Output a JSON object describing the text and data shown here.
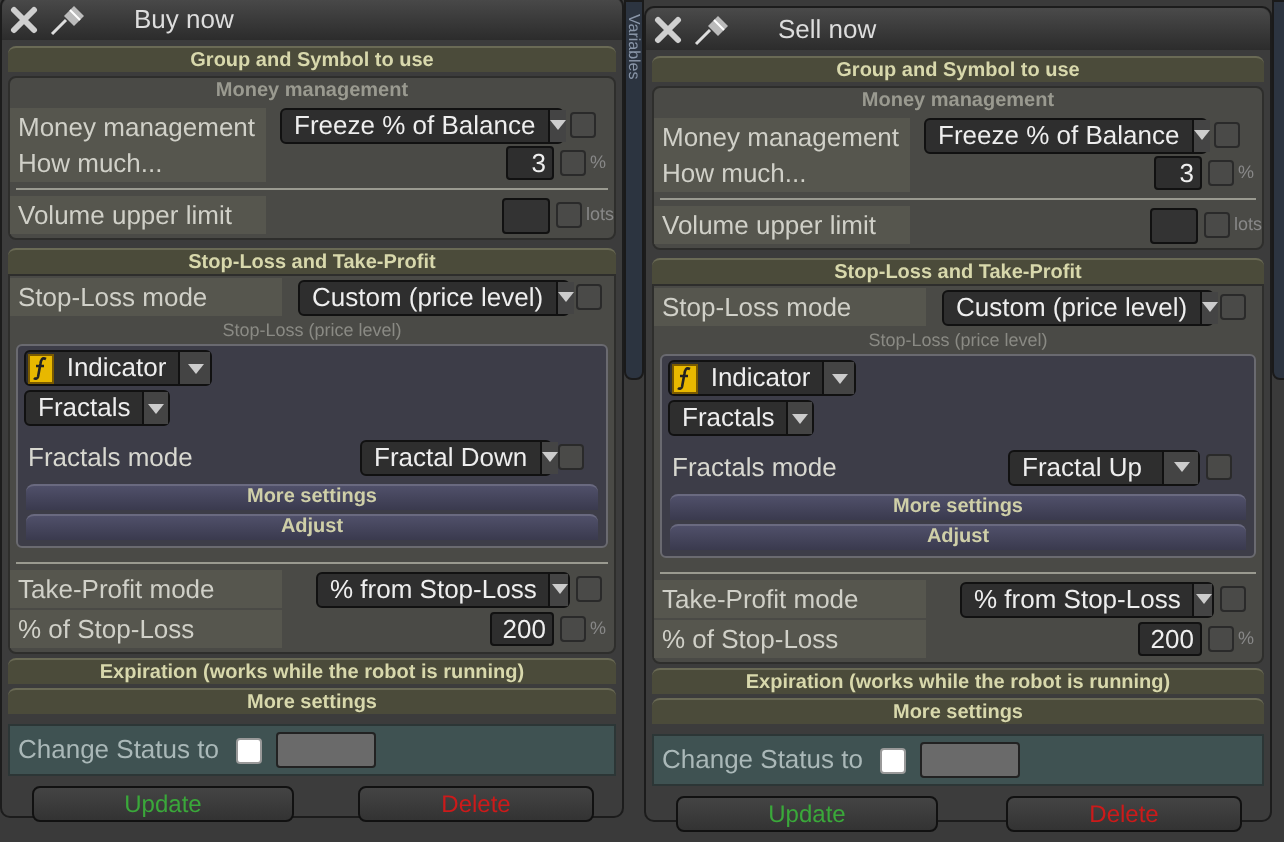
{
  "side_tab": "Variables",
  "windows": [
    {
      "title": "Buy now",
      "group_header": "Group and Symbol to use",
      "money": {
        "title": "Money management",
        "mode": {
          "label": "Money management",
          "value": "Freeze % of Balance",
          "checked": false
        },
        "amount": {
          "label": "How much...",
          "value": "3",
          "unit": "%",
          "checked": false
        },
        "volume_limit": {
          "label": "Volume upper limit",
          "unit": "lots",
          "checked": false
        }
      },
      "stop_take": {
        "title": "Stop-Loss and Take-Profit",
        "sl_mode": {
          "label": "Stop-Loss mode",
          "value": "Custom (price level)",
          "checked": false
        },
        "sl_subtitle": "Stop-Loss (price level)",
        "indicator": "Indicator",
        "indicator_type": "Fractals",
        "fractals_mode": {
          "label": "Fractals mode",
          "value": "Fractal Down",
          "checked": false
        },
        "buttons": [
          "More settings",
          "Adjust"
        ],
        "tp_mode": {
          "label": "Take-Profit mode",
          "value": "% from Stop-Loss",
          "checked": false
        },
        "tp_percent": {
          "label": "% of Stop-Loss",
          "value": "200",
          "unit": "%",
          "checked": false
        }
      },
      "sections": [
        "Expiration (works while the robot is running)",
        "More settings"
      ],
      "status": {
        "label": "Change Status to",
        "checked": false
      },
      "actions": [
        {
          "label": "Update",
          "kind": "confirm"
        },
        {
          "label": "Delete",
          "kind": "danger"
        }
      ]
    },
    {
      "title": "Sell now",
      "group_header": "Group and Symbol to use",
      "money": {
        "title": "Money management",
        "mode": {
          "label": "Money management",
          "value": "Freeze % of Balance",
          "checked": false
        },
        "amount": {
          "label": "How much...",
          "value": "3",
          "unit": "%",
          "checked": false
        },
        "volume_limit": {
          "label": "Volume upper limit",
          "unit": "lots",
          "checked": false
        }
      },
      "stop_take": {
        "title": "Stop-Loss and Take-Profit",
        "sl_mode": {
          "label": "Stop-Loss mode",
          "value": "Custom (price level)",
          "checked": false
        },
        "sl_subtitle": "Stop-Loss (price level)",
        "indicator": "Indicator",
        "indicator_type": "Fractals",
        "fractals_mode": {
          "label": "Fractals mode",
          "value": "Fractal Up",
          "checked": false
        },
        "buttons": [
          "More settings",
          "Adjust"
        ],
        "tp_mode": {
          "label": "Take-Profit mode",
          "value": "% from Stop-Loss",
          "checked": false
        },
        "tp_percent": {
          "label": "% of Stop-Loss",
          "value": "200",
          "unit": "%",
          "checked": false
        }
      },
      "sections": [
        "Expiration (works while the robot is running)",
        "More settings"
      ],
      "status": {
        "label": "Change Status to",
        "checked": false
      },
      "actions": [
        {
          "label": "Update",
          "kind": "confirm"
        },
        {
          "label": "Delete",
          "kind": "danger"
        }
      ]
    }
  ]
}
